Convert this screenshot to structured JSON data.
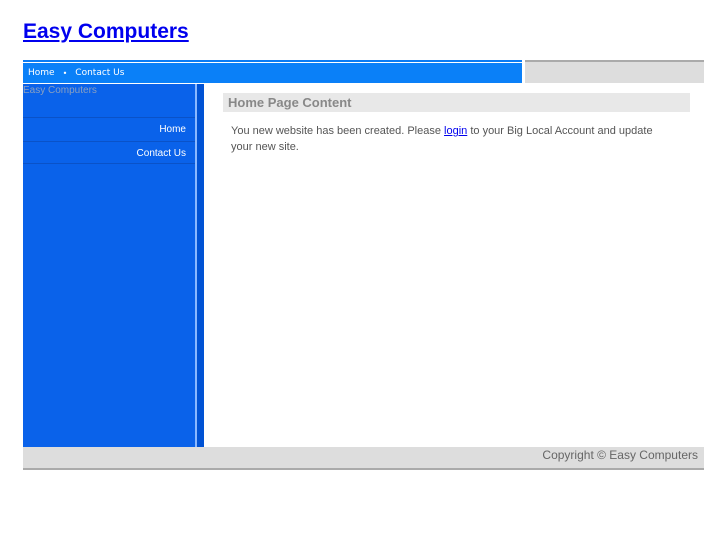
{
  "site_title": "Easy Computers",
  "top_nav": [
    {
      "label": "Home"
    },
    {
      "label": "Contact Us"
    }
  ],
  "top_nav_separator": "•",
  "sidebar": {
    "brand": "Easy Computers",
    "items": [
      {
        "label": "Home"
      },
      {
        "label": "Contact Us"
      }
    ]
  },
  "main": {
    "heading": "Home Page Content",
    "text_before": "You new website has been created. Please ",
    "link": "login",
    "text_after": " to your Big Local Account and update your new site."
  },
  "footer": "Copyright © Easy Computers"
}
